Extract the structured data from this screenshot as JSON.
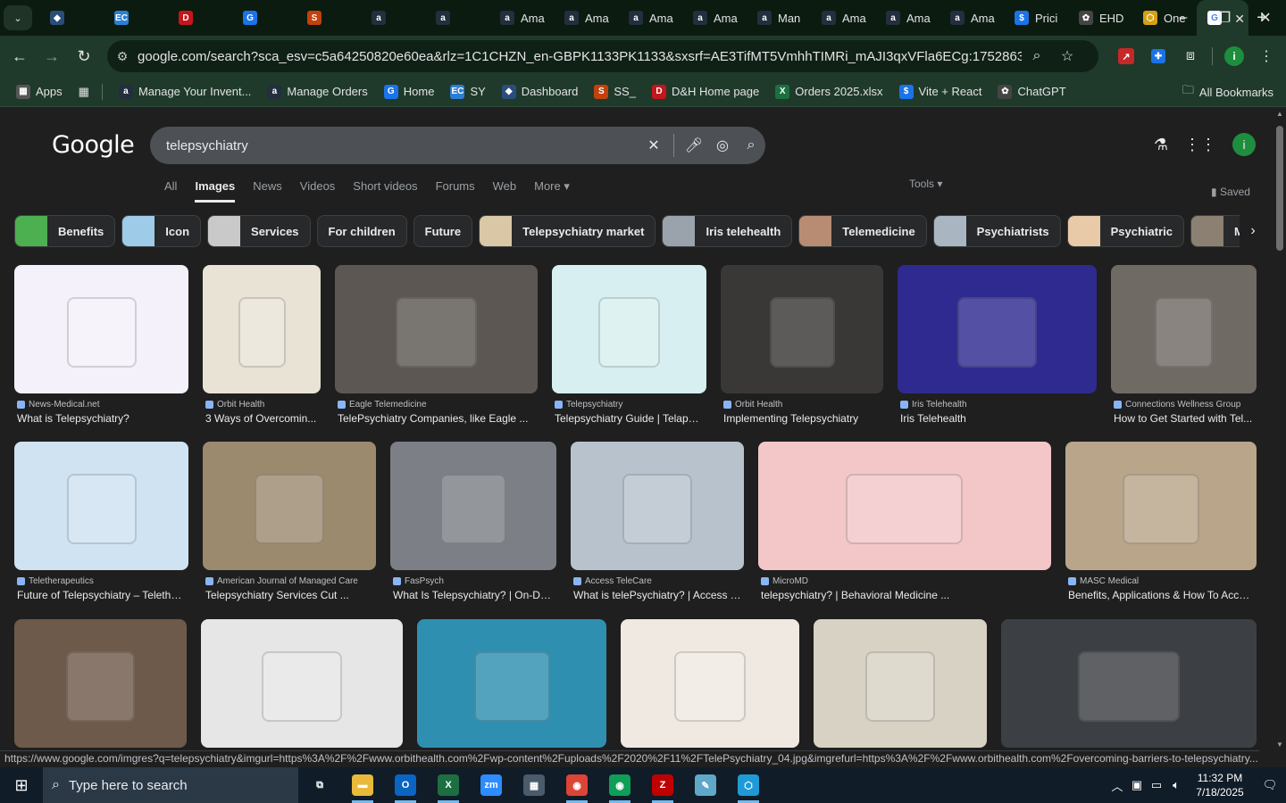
{
  "browser": {
    "tabs": [
      {
        "label": "",
        "icon": "kite-icon",
        "color": "#2a4d7a"
      },
      {
        "label": "",
        "icon": "ec-icon",
        "color": "#2a7fd4"
      },
      {
        "label": "",
        "icon": "dh-icon",
        "color": "#c4161c"
      },
      {
        "label": "",
        "icon": "sheet-icon",
        "color": "#1a73e8"
      },
      {
        "label": "",
        "icon": "ss-icon",
        "color": "#c2410c"
      },
      {
        "label": "",
        "icon": "amazon-icon",
        "color": "#232f3e"
      },
      {
        "label": "",
        "icon": "amazon-icon",
        "color": "#232f3e"
      },
      {
        "label": "Ama",
        "icon": "amazon-icon",
        "color": "#232f3e"
      },
      {
        "label": "Ama",
        "icon": "amazon-icon",
        "color": "#232f3e"
      },
      {
        "label": "Ama",
        "icon": "amazon-icon",
        "color": "#232f3e"
      },
      {
        "label": "Ama",
        "icon": "amazon-icon",
        "color": "#232f3e"
      },
      {
        "label": "Man",
        "icon": "amazon-icon",
        "color": "#232f3e"
      },
      {
        "label": "Ama",
        "icon": "amazon-icon",
        "color": "#232f3e"
      },
      {
        "label": "Ama",
        "icon": "amazon-icon",
        "color": "#232f3e"
      },
      {
        "label": "Ama",
        "icon": "amazon-icon",
        "color": "#232f3e"
      },
      {
        "label": "Prici",
        "icon": "dollar-icon",
        "color": "#1a73e8"
      },
      {
        "label": "EHD",
        "icon": "openai-icon",
        "color": "#444"
      },
      {
        "label": "One",
        "icon": "hexagon-icon",
        "color": "#d4a017"
      }
    ],
    "active_tab_label": "",
    "url": "google.com/search?sca_esv=c5a64250820e60ea&rlz=1C1CHZN_en-GBPK1133PK1133&sxsrf=AE3TifMT5VmhhTIMRi_mAJI3qxVFla6ECg:1752863523324&q=tel...",
    "bookmarks": [
      {
        "label": "Apps",
        "icon": "apps-grid-icon",
        "color": "#555"
      },
      {
        "label": "Manage Your Invent...",
        "icon": "amazon-icon",
        "color": "#232f3e"
      },
      {
        "label": "Manage Orders",
        "icon": "amazon-icon",
        "color": "#232f3e"
      },
      {
        "label": "Home",
        "icon": "sheet-icon",
        "color": "#1a73e8"
      },
      {
        "label": "SY",
        "icon": "ec-icon",
        "color": "#2a7fd4"
      },
      {
        "label": "Dashboard",
        "icon": "kite-icon",
        "color": "#2a4d7a"
      },
      {
        "label": "SS_",
        "icon": "ss-icon",
        "color": "#c2410c"
      },
      {
        "label": "D&H Home page",
        "icon": "dh-icon",
        "color": "#c4161c"
      },
      {
        "label": "Orders 2025.xlsx",
        "icon": "excel-icon",
        "color": "#1d6f42"
      },
      {
        "label": "Vite + React",
        "icon": "dollar-icon",
        "color": "#1a73e8"
      },
      {
        "label": "ChatGPT",
        "icon": "openai-icon",
        "color": "#444"
      }
    ],
    "all_bookmarks": "All Bookmarks"
  },
  "google": {
    "logo": "Google",
    "query": "telepsychiatry",
    "tabs": [
      "All",
      "Images",
      "News",
      "Videos",
      "Short videos",
      "Forums",
      "Web",
      "More ▾"
    ],
    "active_tab": "Images",
    "tools": "Tools ▾",
    "saved": "Saved",
    "avatar_letter": "i",
    "chips": [
      "Benefits",
      "Icon",
      "Services",
      "For children",
      "Future",
      "Telepsychiatry market",
      "Iris telehealth",
      "Telemedicine",
      "Psychiatrists",
      "Psychiatric",
      "Mental health"
    ],
    "results": [
      {
        "source": "News-Medical.net",
        "title": "What is Telepsychiatry?",
        "color": "#f4f1fb"
      },
      {
        "source": "Orbit Health",
        "title": "3 Ways of Overcomin...",
        "color": "#e9e3d6"
      },
      {
        "source": "Eagle Telemedicine",
        "title": "TelePsychiatry Companies, like Eagle ...",
        "color": "#5c5752"
      },
      {
        "source": "Telepsychiatry",
        "title": "Telepsychiatry Guide | Telapsy...",
        "color": "#d7eff0"
      },
      {
        "source": "Orbit Health",
        "title": "Implementing Telepsychiatry",
        "color": "#3a3836"
      },
      {
        "source": "Iris Telehealth",
        "title": "Iris Telehealth",
        "color": "#2f2a8f"
      },
      {
        "source": "Connections Wellness Group",
        "title": "How to Get Started with Tel...",
        "color": "#6f6a64"
      },
      {
        "source": "Teletherapeutics",
        "title": "Future of Telepsychiatry – Telether...",
        "color": "#cfe3f2"
      },
      {
        "source": "American Journal of Managed Care",
        "title": "Telepsychiatry Services Cut ...",
        "color": "#9c8a6f"
      },
      {
        "source": "FasPsych",
        "title": "What Is Telepsychiatry? | On-De...",
        "color": "#7c7f86"
      },
      {
        "source": "Access TeleCare",
        "title": "What is telePsychiatry? | Access T...",
        "color": "#b7c2cc"
      },
      {
        "source": "MicroMD",
        "title": "telepsychiatry? | Behavioral Medicine ...",
        "color": "#f3c6c8"
      },
      {
        "source": "MASC Medical",
        "title": "Benefits, Applications & How To Acces...",
        "color": "#b9a58a"
      },
      {
        "source": "",
        "title": "",
        "color": "#6e5a4a"
      },
      {
        "source": "",
        "title": "",
        "color": "#e6e6e6"
      },
      {
        "source": "",
        "title": "",
        "color": "#2f8fb0"
      },
      {
        "source": "",
        "title": "",
        "color": "#efe9e1"
      },
      {
        "source": "",
        "title": "",
        "color": "#d8d2c4"
      },
      {
        "source": "",
        "title": "",
        "color": "#3c3f44"
      }
    ],
    "status_url": "https://www.google.com/imgres?q=telepsychiatry&imgurl=https%3A%2F%2Fwww.orbithealth.com%2Fwp-content%2Fuploads%2F2020%2F11%2FTelePsychiatry_04.jpg&imgrefurl=https%3A%2F%2Fwww.orbithealth.com%2Fovercoming-barriers-to-telepsychiatry..."
  },
  "taskbar": {
    "search_placeholder": "Type here to search",
    "time": "11:32 PM",
    "date": "7/18/2025",
    "apps": [
      {
        "name": "task-view-icon",
        "glyph": "⧉",
        "color": "transparent",
        "running": false
      },
      {
        "name": "file-explorer-icon",
        "glyph": "▬",
        "color": "#e8b93a",
        "running": true
      },
      {
        "name": "outlook-icon",
        "glyph": "O",
        "color": "#0a64c2",
        "running": true
      },
      {
        "name": "excel-icon",
        "glyph": "X",
        "color": "#1d6f42",
        "running": true
      },
      {
        "name": "zoom-icon",
        "glyph": "zm",
        "color": "#2d8cff",
        "running": false
      },
      {
        "name": "calculator-icon",
        "glyph": "▦",
        "color": "#4a5b6b",
        "running": false
      },
      {
        "name": "chrome-icon",
        "glyph": "◉",
        "color": "#db4437",
        "running": true
      },
      {
        "name": "chrome-profile-icon",
        "glyph": "◉",
        "color": "#0f9d58",
        "running": true
      },
      {
        "name": "filezilla-icon",
        "glyph": "Z",
        "color": "#bf0000",
        "running": true
      },
      {
        "name": "notepad-icon",
        "glyph": "✎",
        "color": "#5fa8c9",
        "running": false
      },
      {
        "name": "app-hex-icon",
        "glyph": "⬡",
        "color": "#1e9bd7",
        "running": true
      }
    ]
  }
}
